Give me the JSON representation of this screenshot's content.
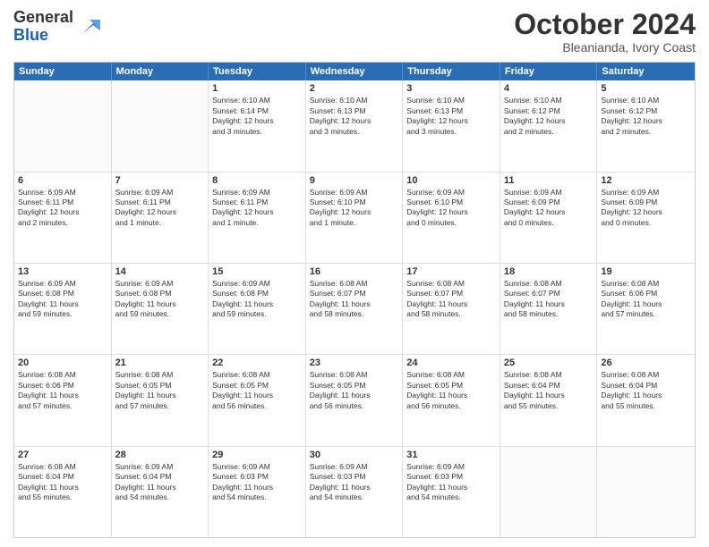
{
  "header": {
    "logo_general": "General",
    "logo_blue": "Blue",
    "month": "October 2024",
    "location": "Bleanianda, Ivory Coast"
  },
  "weekdays": [
    "Sunday",
    "Monday",
    "Tuesday",
    "Wednesday",
    "Thursday",
    "Friday",
    "Saturday"
  ],
  "rows": [
    [
      {
        "day": "",
        "text": "",
        "empty": true
      },
      {
        "day": "",
        "text": "",
        "empty": true
      },
      {
        "day": "1",
        "text": "Sunrise: 6:10 AM\nSunset: 6:14 PM\nDaylight: 12 hours\nand 3 minutes."
      },
      {
        "day": "2",
        "text": "Sunrise: 6:10 AM\nSunset: 6:13 PM\nDaylight: 12 hours\nand 3 minutes."
      },
      {
        "day": "3",
        "text": "Sunrise: 6:10 AM\nSunset: 6:13 PM\nDaylight: 12 hours\nand 3 minutes."
      },
      {
        "day": "4",
        "text": "Sunrise: 6:10 AM\nSunset: 6:12 PM\nDaylight: 12 hours\nand 2 minutes."
      },
      {
        "day": "5",
        "text": "Sunrise: 6:10 AM\nSunset: 6:12 PM\nDaylight: 12 hours\nand 2 minutes."
      }
    ],
    [
      {
        "day": "6",
        "text": "Sunrise: 6:09 AM\nSunset: 6:11 PM\nDaylight: 12 hours\nand 2 minutes."
      },
      {
        "day": "7",
        "text": "Sunrise: 6:09 AM\nSunset: 6:11 PM\nDaylight: 12 hours\nand 1 minute."
      },
      {
        "day": "8",
        "text": "Sunrise: 6:09 AM\nSunset: 6:11 PM\nDaylight: 12 hours\nand 1 minute."
      },
      {
        "day": "9",
        "text": "Sunrise: 6:09 AM\nSunset: 6:10 PM\nDaylight: 12 hours\nand 1 minute."
      },
      {
        "day": "10",
        "text": "Sunrise: 6:09 AM\nSunset: 6:10 PM\nDaylight: 12 hours\nand 0 minutes."
      },
      {
        "day": "11",
        "text": "Sunrise: 6:09 AM\nSunset: 6:09 PM\nDaylight: 12 hours\nand 0 minutes."
      },
      {
        "day": "12",
        "text": "Sunrise: 6:09 AM\nSunset: 6:09 PM\nDaylight: 12 hours\nand 0 minutes."
      }
    ],
    [
      {
        "day": "13",
        "text": "Sunrise: 6:09 AM\nSunset: 6:08 PM\nDaylight: 11 hours\nand 59 minutes."
      },
      {
        "day": "14",
        "text": "Sunrise: 6:09 AM\nSunset: 6:08 PM\nDaylight: 11 hours\nand 59 minutes."
      },
      {
        "day": "15",
        "text": "Sunrise: 6:09 AM\nSunset: 6:08 PM\nDaylight: 11 hours\nand 59 minutes."
      },
      {
        "day": "16",
        "text": "Sunrise: 6:08 AM\nSunset: 6:07 PM\nDaylight: 11 hours\nand 58 minutes."
      },
      {
        "day": "17",
        "text": "Sunrise: 6:08 AM\nSunset: 6:07 PM\nDaylight: 11 hours\nand 58 minutes."
      },
      {
        "day": "18",
        "text": "Sunrise: 6:08 AM\nSunset: 6:07 PM\nDaylight: 11 hours\nand 58 minutes."
      },
      {
        "day": "19",
        "text": "Sunrise: 6:08 AM\nSunset: 6:06 PM\nDaylight: 11 hours\nand 57 minutes."
      }
    ],
    [
      {
        "day": "20",
        "text": "Sunrise: 6:08 AM\nSunset: 6:06 PM\nDaylight: 11 hours\nand 57 minutes."
      },
      {
        "day": "21",
        "text": "Sunrise: 6:08 AM\nSunset: 6:05 PM\nDaylight: 11 hours\nand 57 minutes."
      },
      {
        "day": "22",
        "text": "Sunrise: 6:08 AM\nSunset: 6:05 PM\nDaylight: 11 hours\nand 56 minutes."
      },
      {
        "day": "23",
        "text": "Sunrise: 6:08 AM\nSunset: 6:05 PM\nDaylight: 11 hours\nand 56 minutes."
      },
      {
        "day": "24",
        "text": "Sunrise: 6:08 AM\nSunset: 6:05 PM\nDaylight: 11 hours\nand 56 minutes."
      },
      {
        "day": "25",
        "text": "Sunrise: 6:08 AM\nSunset: 6:04 PM\nDaylight: 11 hours\nand 55 minutes."
      },
      {
        "day": "26",
        "text": "Sunrise: 6:08 AM\nSunset: 6:04 PM\nDaylight: 11 hours\nand 55 minutes."
      }
    ],
    [
      {
        "day": "27",
        "text": "Sunrise: 6:08 AM\nSunset: 6:04 PM\nDaylight: 11 hours\nand 55 minutes."
      },
      {
        "day": "28",
        "text": "Sunrise: 6:09 AM\nSunset: 6:04 PM\nDaylight: 11 hours\nand 54 minutes."
      },
      {
        "day": "29",
        "text": "Sunrise: 6:09 AM\nSunset: 6:03 PM\nDaylight: 11 hours\nand 54 minutes."
      },
      {
        "day": "30",
        "text": "Sunrise: 6:09 AM\nSunset: 6:03 PM\nDaylight: 11 hours\nand 54 minutes."
      },
      {
        "day": "31",
        "text": "Sunrise: 6:09 AM\nSunset: 6:03 PM\nDaylight: 11 hours\nand 54 minutes."
      },
      {
        "day": "",
        "text": "",
        "empty": true
      },
      {
        "day": "",
        "text": "",
        "empty": true
      }
    ]
  ]
}
